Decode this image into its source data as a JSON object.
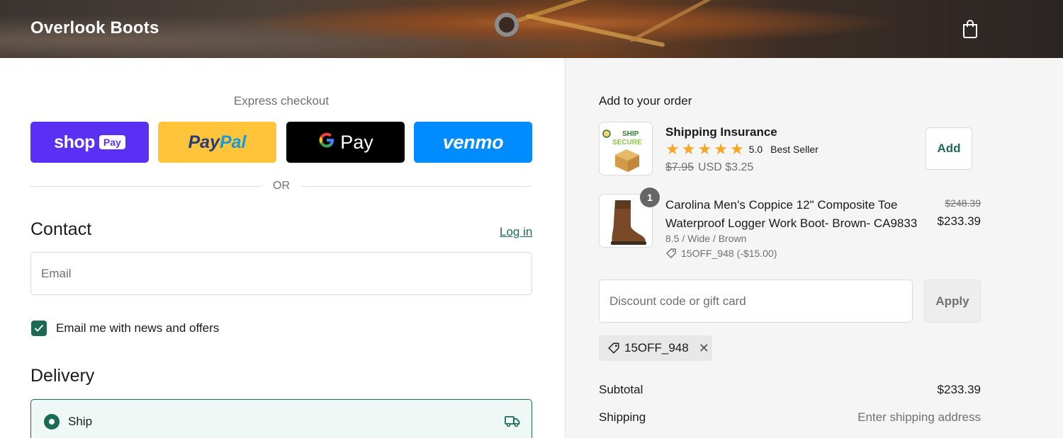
{
  "header": {
    "brand": "Overlook Boots",
    "cart_icon": "shopping-bag-icon"
  },
  "express": {
    "label": "Express checkout",
    "buttons": {
      "shop": {
        "text": "shop",
        "pill": "Pay"
      },
      "paypal": {
        "text_a": "Pay",
        "text_b": "Pal"
      },
      "gpay": {
        "g": "G",
        "text": "Pay"
      },
      "venmo": {
        "text": "venmo"
      }
    },
    "or_text": "OR"
  },
  "contact": {
    "title": "Contact",
    "login": "Log in",
    "email_placeholder": "Email",
    "newsletter_label": "Email me with news and offers",
    "newsletter_checked": true
  },
  "delivery": {
    "title": "Delivery",
    "ship_label": "Ship",
    "ship_icon": "truck-icon"
  },
  "order": {
    "add_title": "Add to your order",
    "insurance": {
      "title": "Shipping Insurance",
      "rating": "5.0",
      "badge": "Best Seller",
      "old_price": "$7.95",
      "price": "USD $3.25",
      "add_label": "Add",
      "thumb_text_1": "SHIP",
      "thumb_text_2": "SECURE"
    },
    "item": {
      "quantity": "1",
      "title": "Carolina Men's Coppice 12\" Composite Toe Waterproof Logger Work Boot- Brown- CA9833",
      "variant": "8.5 / Wide / Brown",
      "discount": "15OFF_948 (-$15.00)",
      "old_price": "$248.39",
      "price": "$233.39"
    },
    "discount_placeholder": "Discount code or gift card",
    "apply_label": "Apply",
    "applied_code": "15OFF_948",
    "summary": {
      "subtotal_label": "Subtotal",
      "subtotal_value": "$233.39",
      "shipping_label": "Shipping",
      "shipping_value": "Enter shipping address"
    }
  },
  "colors": {
    "accent": "#1b6b54",
    "shop_pay": "#5a31f4",
    "paypal": "#ffc439",
    "gpay": "#000000",
    "venmo": "#008cff",
    "star": "#f5a623"
  }
}
